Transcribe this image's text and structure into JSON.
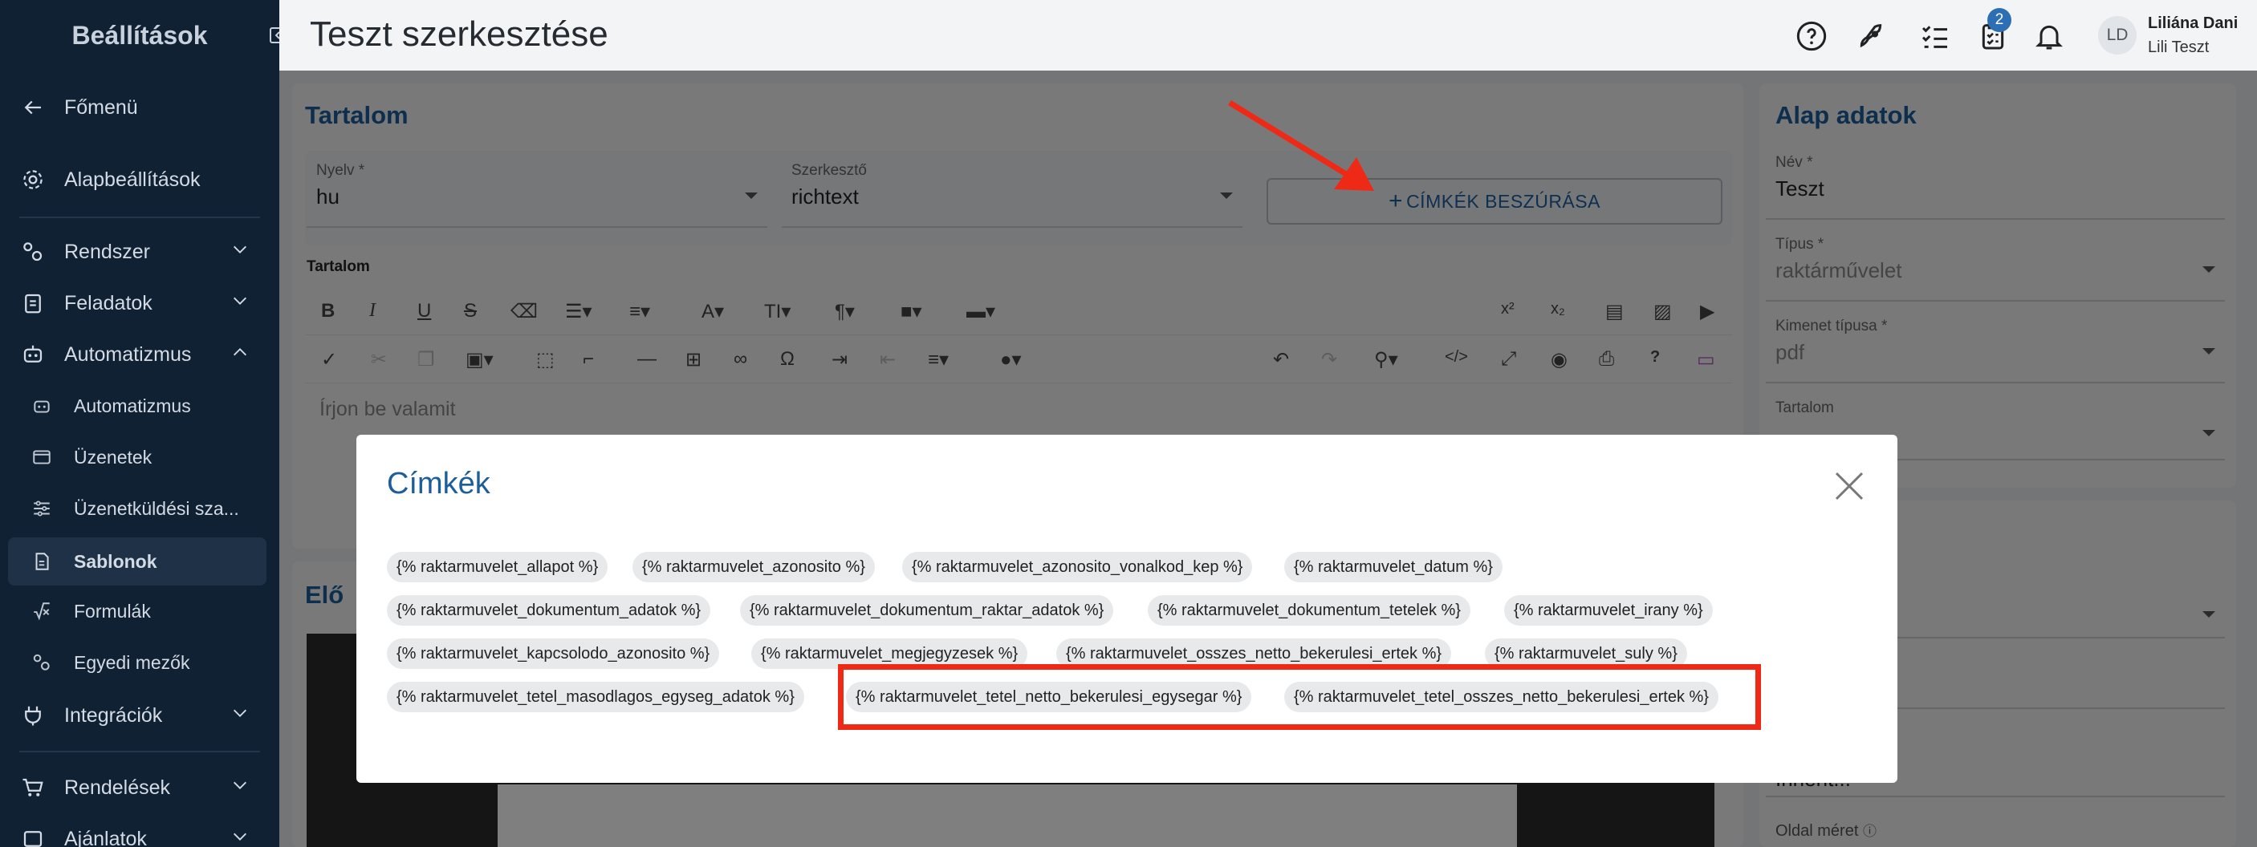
{
  "sidebar": {
    "title": "Beállítások",
    "items": [
      {
        "label": "Főmenü"
      },
      {
        "label": "Alapbeállítások"
      },
      {
        "label": "Rendszer"
      },
      {
        "label": "Feladatok"
      },
      {
        "label": "Automatizmus"
      },
      {
        "label": "Automatizmus"
      },
      {
        "label": "Üzenetek"
      },
      {
        "label": "Üzenetküldési sza..."
      },
      {
        "label": "Sablonok"
      },
      {
        "label": "Formulák"
      },
      {
        "label": "Egyedi mezők"
      },
      {
        "label": "Integrációk"
      },
      {
        "label": "Rendelések"
      },
      {
        "label": "Ajánlatok"
      }
    ]
  },
  "header": {
    "title": "Teszt szerkesztése",
    "tasks_badge": "2",
    "avatar_initials": "LD",
    "user_name": "Liliána Dani",
    "user_sub": "Lili Teszt"
  },
  "content_panel": {
    "title": "Tartalom",
    "language_label": "Nyelv *",
    "language_value": "hu",
    "editor_label": "Szerkesztő",
    "editor_value": "richtext",
    "insert_button": "CÍMKÉK BESZÚRÁSA",
    "content_label": "Tartalom",
    "placeholder": "Írjon be valamit"
  },
  "preview_panel": {
    "title": "Elő"
  },
  "basic_panel": {
    "title": "Alap adatok",
    "name_label": "Név *",
    "name_value": "Teszt",
    "type_label": "Típus *",
    "type_value": "raktárművelet",
    "output_label": "Kimenet típusa *",
    "output_value": "pdf",
    "content_label": "Tartalom",
    "partial_text": "Innent...",
    "page_size_label": "Oldal méret"
  },
  "modal": {
    "title": "Címkék",
    "tags": [
      "{% raktarmuvelet_allapot %}",
      "{% raktarmuvelet_azonosito %}",
      "{% raktarmuvelet_azonosito_vonalkod_kep %}",
      "{% raktarmuvelet_datum %}",
      "{% raktarmuvelet_dokumentum_adatok %}",
      "{% raktarmuvelet_dokumentum_raktar_adatok %}",
      "{% raktarmuvelet_dokumentum_tetelek %}",
      "{% raktarmuvelet_irany %}",
      "{% raktarmuvelet_kapcsolodo_azonosito %}",
      "{% raktarmuvelet_megjegyzesek %}",
      "{% raktarmuvelet_osszes_netto_bekerulesi_ertek %}",
      "{% raktarmuvelet_suly %}",
      "{% raktarmuvelet_tetel_masodlagos_egyseg_adatok %}",
      "{% raktarmuvelet_tetel_netto_bekerulesi_egysegar %}",
      "{% raktarmuvelet_tetel_osszes_netto_bekerulesi_ertek %}"
    ]
  },
  "colors": {
    "accent": "#1d5d9b",
    "sidebar": "#102134",
    "annotation": "#ee2a17"
  }
}
